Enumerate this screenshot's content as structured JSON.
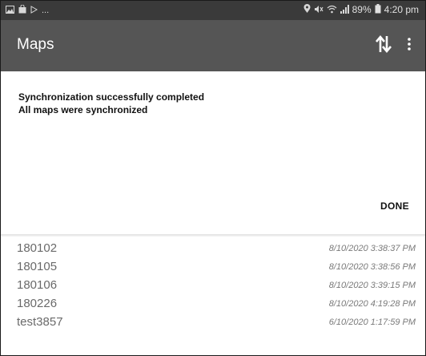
{
  "status_bar": {
    "left_icons": [
      "gallery-icon",
      "bag-icon",
      "play-icon"
    ],
    "ellipsis": "...",
    "right_icons": [
      "location-icon",
      "mute-icon",
      "wifi-icon",
      "signal-icon"
    ],
    "battery": "89%",
    "time": "4:20 pm"
  },
  "appbar": {
    "title": "Maps",
    "actions": [
      "sync-icon",
      "more-vert-icon"
    ]
  },
  "dialog": {
    "line1": "Synchronization successfully completed",
    "line2": "All maps were synchronized",
    "done_label": "DONE"
  },
  "maps": [
    {
      "name": "180102",
      "date": "8/10/2020 3:38:37 PM"
    },
    {
      "name": "180105",
      "date": "8/10/2020 3:38:56 PM"
    },
    {
      "name": "180106",
      "date": "8/10/2020 3:39:15 PM"
    },
    {
      "name": "180226",
      "date": "8/10/2020 4:19:28 PM"
    },
    {
      "name": "test3857",
      "date": "6/10/2020 1:17:59 PM"
    }
  ],
  "colors": {
    "status_bar": "#3a3a3a",
    "app_bar": "#555555",
    "background": "#ffffff",
    "list_text": "#6a6a6a"
  }
}
